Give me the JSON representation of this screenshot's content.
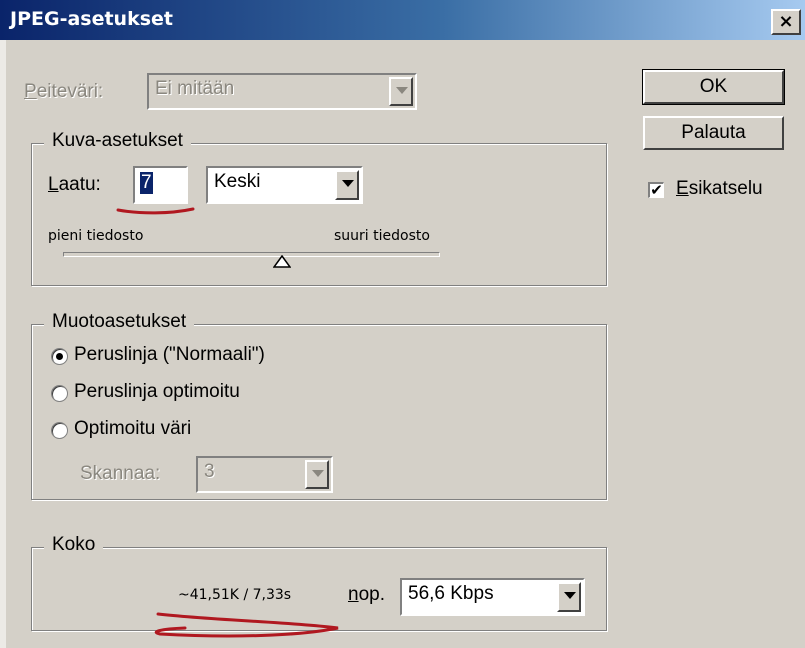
{
  "window": {
    "title": "JPEG-asetukset",
    "close_label": "×"
  },
  "matte": {
    "label_u": "P",
    "label_rest": "eiteväri:",
    "value": "Ei mitään"
  },
  "image_options": {
    "legend": "Kuva-asetukset",
    "quality_label_u": "L",
    "quality_label_rest": "aatu:",
    "quality_value": "7",
    "quality_preset": "Keski",
    "slider_min_label": "pieni tiedosto",
    "slider_max_label": "suuri tiedosto",
    "slider_level_fraction": 0.58
  },
  "format_options": {
    "legend": "Muotoasetukset",
    "options": [
      "Peruslinja (\"Normaali\")",
      "Peruslinja optimoitu",
      "Optimoitu väri"
    ],
    "selected_index": 0,
    "scans_label": "Skannaa:",
    "scans_value": "3"
  },
  "size": {
    "legend": "Koko",
    "estimate": "~41,51K / 7,33s",
    "speed_label_u": "n",
    "speed_label_rest": "op.",
    "speed_value": "56,6 Kbps"
  },
  "buttons": {
    "ok": "OK",
    "reset": "Palauta"
  },
  "preview": {
    "label_u": "E",
    "label_rest": "sikatselu",
    "checked": true
  },
  "colors": {
    "titlebar_start": "#0a246a",
    "titlebar_end": "#a6caf0",
    "dialog": "#d4d0c8",
    "annotation": "#b01820"
  }
}
